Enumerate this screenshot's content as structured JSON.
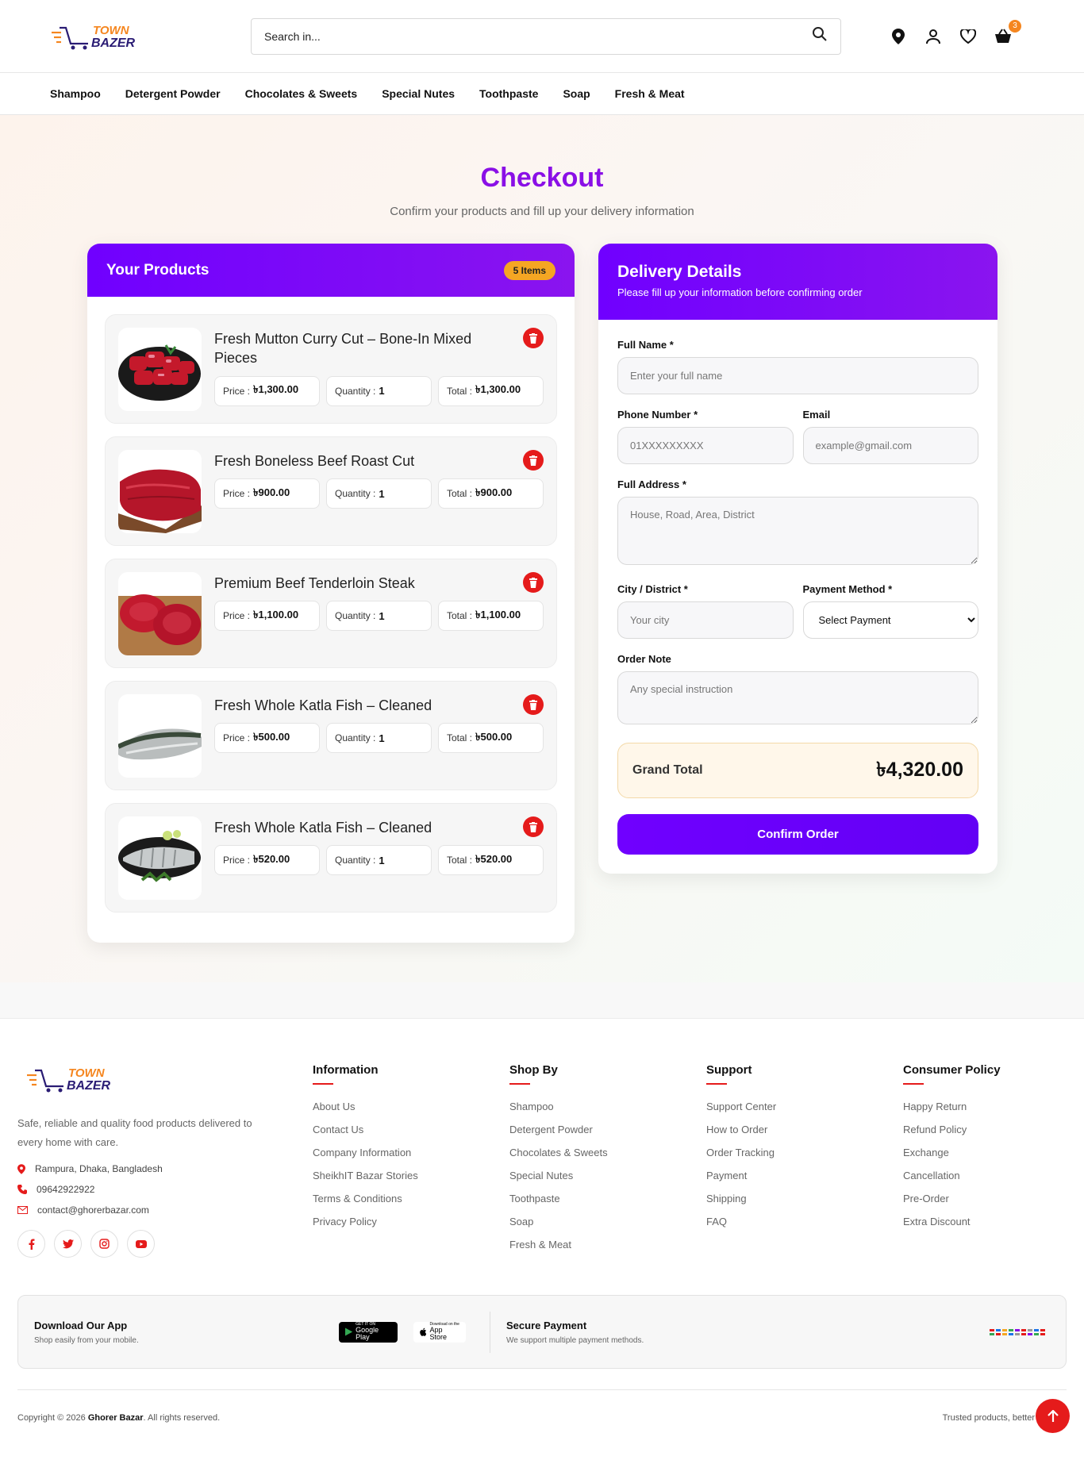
{
  "header": {
    "logo_line1": "TOWN",
    "logo_line2": "BAZER",
    "search_placeholder": "Search in...",
    "cart_count": "3"
  },
  "nav": [
    "Shampoo",
    "Detergent Powder",
    "Chocolates & Sweets",
    "Special Nutes",
    "Toothpaste",
    "Soap",
    "Fresh & Meat"
  ],
  "page": {
    "title": "Checkout",
    "subtitle": "Confirm your products and fill up your delivery information"
  },
  "products": {
    "heading": "Your Products",
    "count_label": "5 Items",
    "price_label": "Price :",
    "qty_label": "Quantity :",
    "total_label": "Total :",
    "items": [
      {
        "name": "Fresh Mutton Curry Cut – Bone-In Mixed Pieces",
        "price": "৳1,300.00",
        "qty": "1",
        "total": "৳1,300.00"
      },
      {
        "name": "Fresh Boneless Beef Roast Cut",
        "price": "৳900.00",
        "qty": "1",
        "total": "৳900.00"
      },
      {
        "name": "Premium Beef Tenderloin Steak",
        "price": "৳1,100.00",
        "qty": "1",
        "total": "৳1,100.00"
      },
      {
        "name": "Fresh Whole Katla Fish – Cleaned",
        "price": "৳500.00",
        "qty": "1",
        "total": "৳500.00"
      },
      {
        "name": "Fresh Whole Katla Fish – Cleaned",
        "price": "৳520.00",
        "qty": "1",
        "total": "৳520.00"
      }
    ]
  },
  "delivery": {
    "heading": "Delivery Details",
    "subheading": "Please fill up your information before confirming order",
    "full_name_label": "Full Name *",
    "full_name_placeholder": "Enter your full name",
    "phone_label": "Phone Number *",
    "phone_placeholder": "01XXXXXXXXX",
    "email_label": "Email",
    "email_placeholder": "example@gmail.com",
    "address_label": "Full Address *",
    "address_placeholder": "House, Road, Area, District",
    "city_label": "City / District *",
    "city_placeholder": "Your city",
    "payment_label": "Payment Method *",
    "payment_selected": "Select Payment",
    "note_label": "Order Note",
    "note_placeholder": "Any special instruction",
    "grand_total_label": "Grand Total",
    "grand_total_value": "৳4,320.00",
    "confirm_label": "Confirm Order"
  },
  "footer": {
    "description": "Safe, reliable and quality food products delivered to every home with care.",
    "address": "Rampura, Dhaka, Bangladesh",
    "phone": "09642922922",
    "email": "contact@ghorerbazar.com",
    "columns": [
      {
        "title": "Information",
        "links": [
          "About Us",
          "Contact Us",
          "Company Information",
          "SheikhIT Bazar Stories",
          "Terms & Conditions",
          "Privacy Policy"
        ]
      },
      {
        "title": "Shop By",
        "links": [
          "Shampoo",
          "Detergent Powder",
          "Chocolates & Sweets",
          "Special Nutes",
          "Toothpaste",
          "Soap",
          "Fresh & Meat"
        ]
      },
      {
        "title": "Support",
        "links": [
          "Support Center",
          "How to Order",
          "Order Tracking",
          "Payment",
          "Shipping",
          "FAQ"
        ]
      },
      {
        "title": "Consumer Policy",
        "links": [
          "Happy Return",
          "Refund Policy",
          "Exchange",
          "Cancellation",
          "Pre-Order",
          "Extra Discount"
        ]
      }
    ],
    "app_title": "Download Our App",
    "app_sub": "Shop easily from your mobile.",
    "google_play_small": "GET IT ON",
    "google_play": "Google Play",
    "app_store_small": "Download on the",
    "app_store": "App Store",
    "secure_title": "Secure Payment",
    "secure_sub": "We support multiple payment methods.",
    "copyright_prefix": "Copyright © 2026 ",
    "copyright_brand": "Ghorer Bazar",
    "copyright_suffix": ". All rights reserved.",
    "tagline": "Trusted products, better"
  },
  "colors": {
    "brand_purple": "#7000ff",
    "accent_orange": "#f5a623",
    "danger_red": "#e51b1b"
  }
}
